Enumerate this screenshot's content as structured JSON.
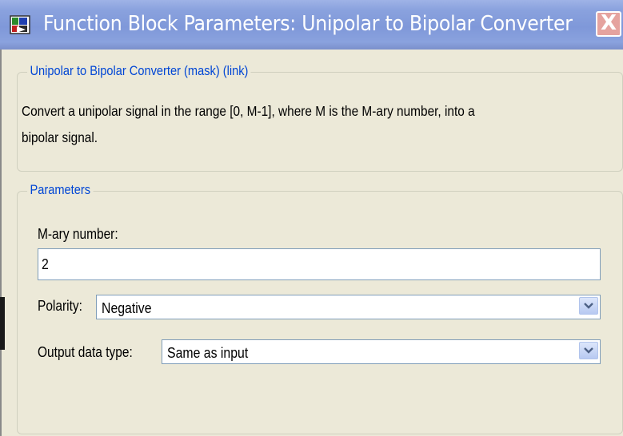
{
  "window": {
    "title": "Function Block Parameters: Unipolar to Bipolar Converter",
    "close_label": "X",
    "icon": "simulink-block-icon"
  },
  "description_group": {
    "legend": "Unipolar to Bipolar Converter (mask) (link)",
    "lines": [
      "Convert a unipolar signal in the range [0, M-1], where M is the M-ary number,  into a",
      "bipolar signal."
    ]
  },
  "parameters_group": {
    "legend": "Parameters",
    "mary_label": "M-ary number:",
    "mary_value": "2",
    "polarity_label": "Polarity:",
    "polarity_value": "Negative",
    "output_type_label": "Output data type:",
    "output_type_value": "Same as input"
  },
  "colors": {
    "titlebar": "#8aa2de",
    "legend_text": "#0046d5",
    "dialog_bg": "#ece9d8",
    "close_button": "#e5a39f"
  }
}
